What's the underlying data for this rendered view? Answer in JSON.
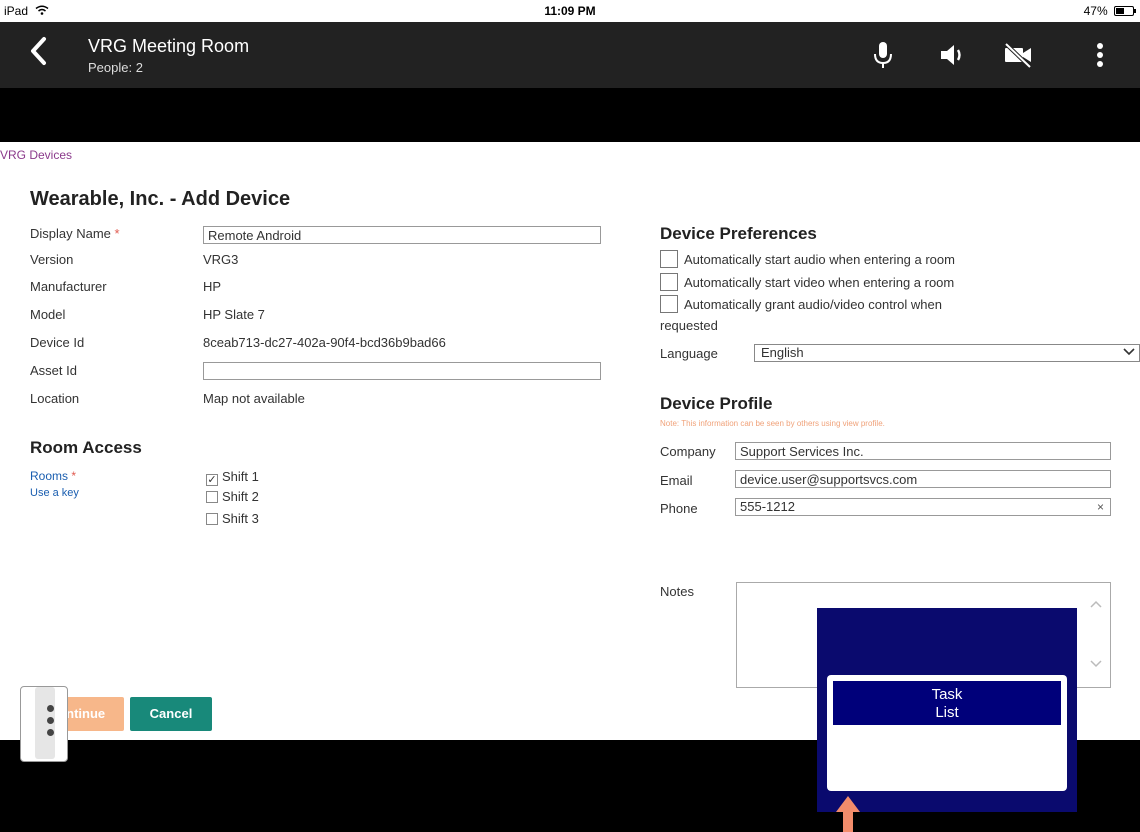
{
  "status_bar": {
    "device": "iPad",
    "time": "11:09 PM",
    "battery": "47%",
    "battery_level": 0.47
  },
  "header": {
    "title": "VRG Meeting Room",
    "subtitle": "People: 2"
  },
  "icons": {
    "back": "chevron-left-icon",
    "mic": "microphone-icon",
    "speaker": "speaker-icon",
    "video": "video-off-icon",
    "more": "more-vertical-icon"
  },
  "page": {
    "breadcrumb": "VRG Devices",
    "title": "Wearable, Inc. - Add Device"
  },
  "device": {
    "display_name_label": "Display Name",
    "display_name_value": "Remote Android",
    "version_label": "Version",
    "version_value": "VRG3",
    "manufacturer_label": "Manufacturer",
    "manufacturer_value": "HP",
    "model_label": "Model",
    "model_value": "HP Slate 7",
    "device_id_label": "Device Id",
    "device_id_value": "8ceab713-dc27-402a-90f4-bcd36b9bad66",
    "asset_id_label": "Asset Id",
    "asset_id_value": "",
    "location_label": "Location",
    "location_value": "Map not available",
    "required_mark": "*"
  },
  "room_access": {
    "title": "Room Access",
    "rooms_label": "Rooms",
    "use_key": "Use a key",
    "rooms": [
      {
        "label": "Shift 1",
        "checked": true
      },
      {
        "label": "Shift 2",
        "checked": false
      },
      {
        "label": "Shift 3",
        "checked": false
      }
    ],
    "checkmark": "✓"
  },
  "preferences": {
    "title": "Device Preferences",
    "auto_audio": "Automatically start audio when entering a room",
    "auto_video": "Automatically start video when entering a room",
    "auto_grant": "Automatically grant audio/video control when",
    "auto_grant_cont": "requested",
    "language_label": "Language",
    "language_value": "English"
  },
  "profile": {
    "title": "Device Profile",
    "note": "Note: This information can be seen by others using view profile.",
    "company_label": "Company",
    "company_value": "Support Services Inc.",
    "email_label": "Email",
    "email_value": "device.user@supportsvcs.com",
    "phone_label": "Phone",
    "phone_value": "555-1212",
    "clear": "×",
    "notes_label": "Notes"
  },
  "buttons": {
    "continue": "Continue",
    "cancel": "Cancel"
  },
  "task_panel": {
    "line1": "Task",
    "line2": "List"
  },
  "colors": {
    "header_bg": "#222222",
    "continue": "#f7b78a",
    "cancel": "#18897a",
    "task_panel": "#0a0a6e",
    "arrow": "#f28c6b",
    "breadcrumb": "#8b3a8b",
    "link": "#1a5eb0"
  }
}
